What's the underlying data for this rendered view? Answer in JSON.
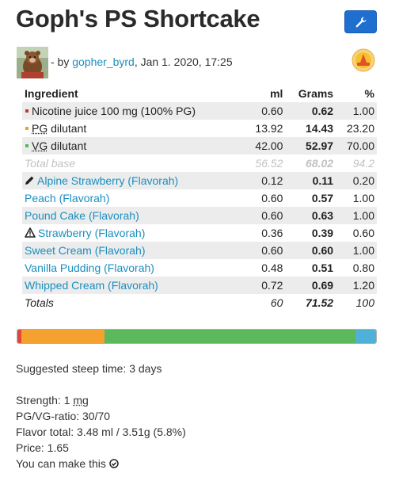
{
  "title": "Goph's PS Shortcake",
  "header": {
    "tool_icon": "wrench-icon",
    "by_prefix": "- by",
    "author": "gopher_byrd",
    "date": ", Jan 1. 2020, 17:25",
    "badge_icon": "supporter-badge-icon"
  },
  "table": {
    "headers": [
      "Ingredient",
      "ml",
      "Grams",
      "%"
    ],
    "base": [
      {
        "name": "Nicotine juice 100 mg (100% PG)",
        "ml": "0.60",
        "grams": "0.62",
        "pct": "1.00",
        "color": "#cc3333"
      },
      {
        "name_u": "PG",
        "name_rest": " dilutant",
        "ml": "13.92",
        "grams": "14.43",
        "pct": "23.20",
        "color": "#f0a030"
      },
      {
        "name_u": "VG",
        "name_rest": " dilutant",
        "ml": "42.00",
        "grams": "52.97",
        "pct": "70.00",
        "color": "#5cb85c"
      }
    ],
    "total_base": {
      "label": "Total base",
      "ml": "56.52",
      "grams": "68.02",
      "pct": "94.2"
    },
    "flavors": [
      {
        "name": "Alpine Strawberry (Flavorah)",
        "ml": "0.12",
        "grams": "0.11",
        "pct": "0.20",
        "icon": "pencil-icon"
      },
      {
        "name": "Peach (Flavorah)",
        "ml": "0.60",
        "grams": "0.57",
        "pct": "1.00"
      },
      {
        "name": "Pound Cake (Flavorah)",
        "ml": "0.60",
        "grams": "0.63",
        "pct": "1.00"
      },
      {
        "name": "Strawberry (Flavorah)",
        "ml": "0.36",
        "grams": "0.39",
        "pct": "0.60",
        "icon": "warning-icon"
      },
      {
        "name": "Sweet Cream (Flavorah)",
        "ml": "0.60",
        "grams": "0.60",
        "pct": "1.00"
      },
      {
        "name": "Vanilla Pudding (Flavorah)",
        "ml": "0.48",
        "grams": "0.51",
        "pct": "0.80"
      },
      {
        "name": "Whipped Cream (Flavorah)",
        "ml": "0.72",
        "grams": "0.69",
        "pct": "1.20"
      }
    ],
    "totals": {
      "label": "Totals",
      "ml": "60",
      "grams": "71.52",
      "pct": "100"
    }
  },
  "composition_bar": [
    {
      "name": "nicotine",
      "pct": 1.0,
      "color": "#e0463a"
    },
    {
      "name": "pg",
      "pct": 23.2,
      "color": "#f5a130"
    },
    {
      "name": "vg",
      "pct": 70.0,
      "color": "#5cb85c"
    },
    {
      "name": "flavor",
      "pct": 5.8,
      "color": "#4fb0d8"
    }
  ],
  "info": {
    "steep": "Suggested steep time: 3 days",
    "strength_label": "Strength: 1 ",
    "strength_unit": "mg",
    "ratio": "PG/VG-ratio: 30/70",
    "flavor_total": "Flavor total: 3.48 ml / 3.51g (5.8%)",
    "price": "Price: 1.65",
    "make_label": "You can make this",
    "make_icon": "check-circle-icon"
  }
}
